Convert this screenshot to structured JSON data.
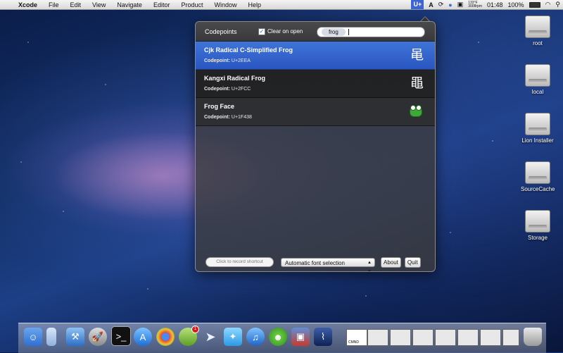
{
  "menubar": {
    "app_name": "Xcode",
    "items": [
      "File",
      "Edit",
      "View",
      "Navigate",
      "Editor",
      "Product",
      "Window",
      "Help"
    ],
    "status": {
      "uplus": "U+",
      "temp_top": "133°F",
      "temp_bottom": "3008rpm",
      "time": "01:48",
      "battery": "100%"
    }
  },
  "panel": {
    "title": "Codepoints",
    "clear_on_open_label": "Clear on open",
    "clear_on_open_checked": true,
    "search_value": "frog",
    "results": [
      {
        "name": "Cjk Radical C-Simplified Frog",
        "codepoint_label": "Codepoint:",
        "codepoint": "U+2EEA",
        "glyph": "⻪"
      },
      {
        "name": "Kangxi Radical Frog",
        "codepoint_label": "Codepoint:",
        "codepoint": "U+2FCC",
        "glyph": "⿌"
      },
      {
        "name": "Frog Face",
        "codepoint_label": "Codepoint:",
        "codepoint": "U+1F438",
        "glyph": "frog-face-icon"
      }
    ],
    "footer": {
      "shortcut_placeholder": "Click to record shortcut",
      "font_selection": "Automatic font selection",
      "about_label": "About",
      "quit_label": "Quit"
    }
  },
  "desktop": {
    "drives": [
      "root",
      "local",
      "Lion Installer",
      "SourceCache",
      "Storage"
    ]
  },
  "dock": {
    "badge_count": "1",
    "cmnd_label": "CMND"
  }
}
